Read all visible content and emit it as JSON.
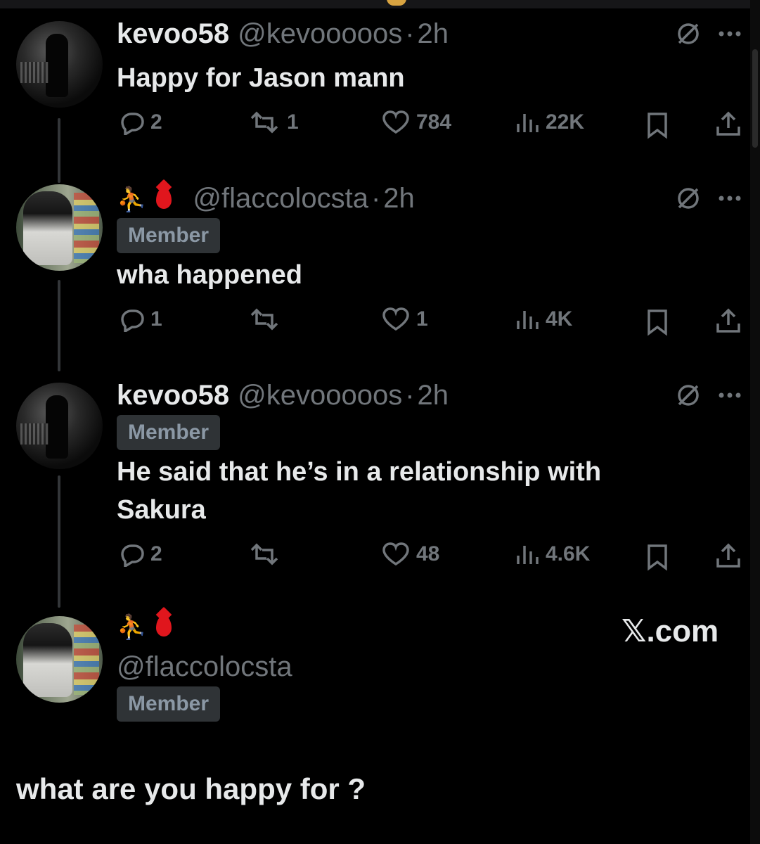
{
  "posts": [
    {
      "name": "kevoo58",
      "handle": "@kevooooos",
      "time": "2h",
      "text": "Happy for Jason mann",
      "replies": "2",
      "reposts": "1",
      "likes": "784",
      "views": "22K"
    },
    {
      "name_emoji": "⛹",
      "handle": "@flaccolocsta",
      "time": "2h",
      "badge": "Member",
      "text": "wha happened",
      "replies": "1",
      "reposts": "",
      "likes": "1",
      "views": "4K"
    },
    {
      "name": "kevoo58",
      "handle": "@kevooooos",
      "time": "2h",
      "badge": "Member",
      "text_line1": "He said that he’s in a relationship with",
      "text_line2": "Sakura",
      "replies": "2",
      "reposts": "",
      "likes": "48",
      "views": "4.6K"
    }
  ],
  "composer": {
    "name_emoji": "⛹",
    "handle": "@flaccolocsta",
    "badge": "Member",
    "text": "what are you happy for ?"
  },
  "watermark": "𝕏.com",
  "separator": "·",
  "icons": [
    "reply-icon",
    "repost-icon",
    "like-icon",
    "views-icon",
    "bookmark-icon",
    "share-icon",
    "grok-icon",
    "more-icon"
  ]
}
